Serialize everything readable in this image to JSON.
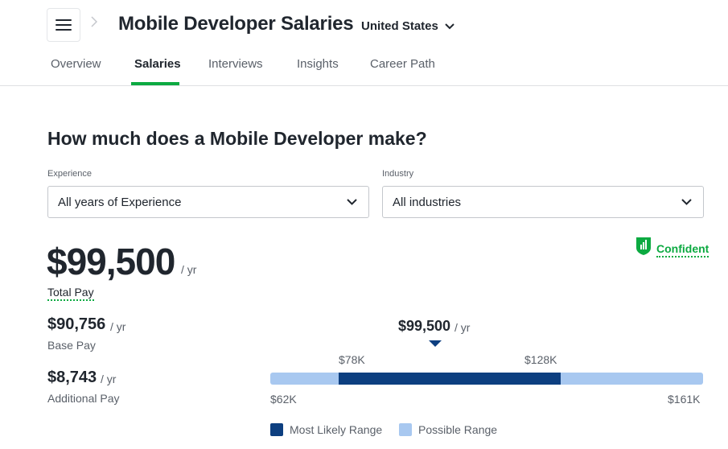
{
  "header": {
    "menu_icon": "hamburger-menu-icon",
    "breadcrumb_icon": "chevron-right-icon",
    "title": "Mobile Developer Salaries",
    "location": "United States",
    "location_icon": "chevron-down-icon"
  },
  "tabs": [
    {
      "label": "Overview",
      "active": false
    },
    {
      "label": "Salaries",
      "active": true
    },
    {
      "label": "Interviews",
      "active": false
    },
    {
      "label": "Insights",
      "active": false
    },
    {
      "label": "Career Path",
      "active": false
    }
  ],
  "main": {
    "heading": "How much does a Mobile Developer make?",
    "filters": {
      "experience": {
        "label": "Experience",
        "value": "All years of Experience"
      },
      "industry": {
        "label": "Industry",
        "value": "All industries"
      }
    },
    "confidence": {
      "label": "Confident",
      "icon": "confidence-shield-icon"
    },
    "total_pay": {
      "amount": "$99,500",
      "unit": "/ yr",
      "label": "Total Pay"
    },
    "base_pay": {
      "amount": "$90,756",
      "unit": "/ yr",
      "label": "Base Pay"
    },
    "additional_pay": {
      "amount": "$8,743",
      "unit": "/ yr",
      "label": "Additional Pay"
    },
    "range_chart": {
      "median": {
        "amount": "$99,500",
        "unit": "/ yr",
        "value": 99500
      },
      "likely_low": "$78K",
      "likely_high": "$128K",
      "possible_low": "$62K",
      "possible_high": "$161K",
      "legend": {
        "most_likely": "Most Likely Range",
        "possible": "Possible Range"
      }
    }
  },
  "colors": {
    "accent_green": "#0caa41",
    "most_likely": "#0d3f80",
    "possible": "#a8c8f0"
  }
}
